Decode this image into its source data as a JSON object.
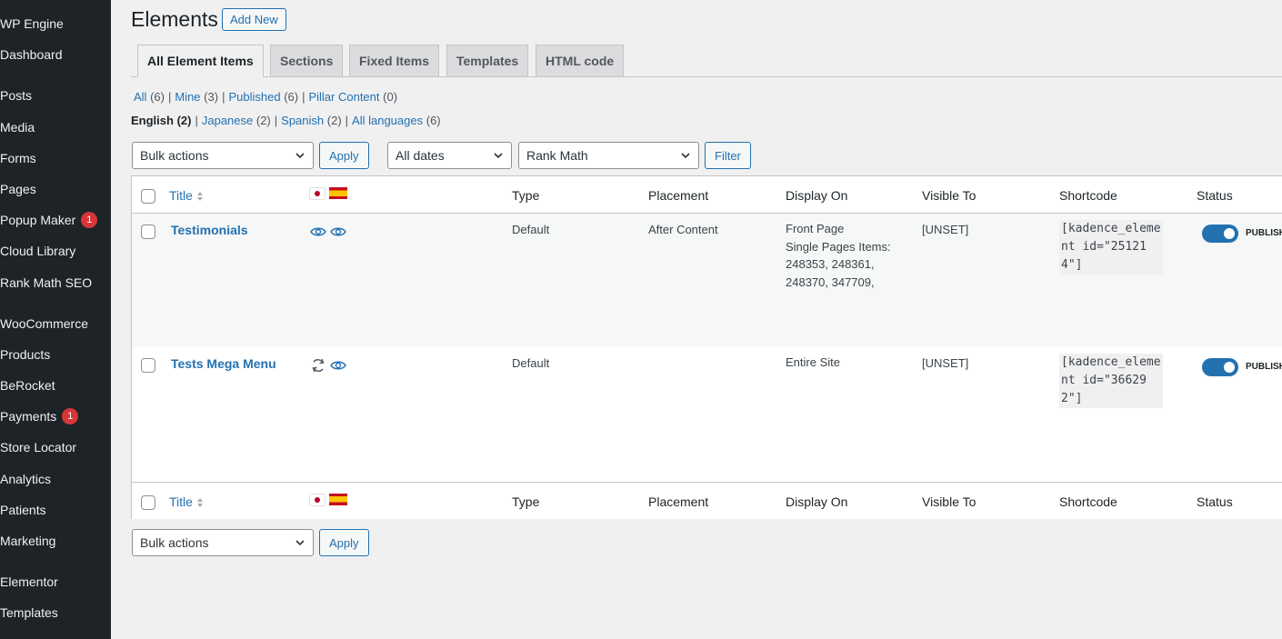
{
  "sidebar": {
    "items": [
      {
        "label": "WP Engine"
      },
      {
        "label": "Dashboard"
      },
      {
        "label": "Posts"
      },
      {
        "label": "Media"
      },
      {
        "label": "Forms"
      },
      {
        "label": "Pages"
      },
      {
        "label": "Popup Maker",
        "badge": "1"
      },
      {
        "label": "Cloud Library"
      },
      {
        "label": "Rank Math SEO"
      },
      {
        "label": "WooCommerce"
      },
      {
        "label": "Products"
      },
      {
        "label": "BeRocket"
      },
      {
        "label": "Payments",
        "badge": "1"
      },
      {
        "label": "Store Locator"
      },
      {
        "label": "Analytics"
      },
      {
        "label": "Patients"
      },
      {
        "label": "Marketing"
      },
      {
        "label": "Elementor"
      },
      {
        "label": "Templates"
      }
    ]
  },
  "header": {
    "title": "Elements",
    "add_new": "Add New"
  },
  "tabs": [
    {
      "label": "All Element Items",
      "active": true
    },
    {
      "label": "Sections"
    },
    {
      "label": "Fixed Items"
    },
    {
      "label": "Templates"
    },
    {
      "label": "HTML code"
    }
  ],
  "views": [
    {
      "label": "All",
      "count": "(6)"
    },
    {
      "label": "Mine",
      "count": "(3)"
    },
    {
      "label": "Published",
      "count": "(6)"
    },
    {
      "label": "Pillar Content",
      "count": "(0)"
    }
  ],
  "languages": [
    {
      "label": "English",
      "count": "(2)",
      "current": true
    },
    {
      "label": "Japanese",
      "count": "(2)"
    },
    {
      "label": "Spanish",
      "count": "(2)"
    },
    {
      "label": "All languages",
      "count": "(6)"
    }
  ],
  "filters": {
    "bulk_actions": "Bulk actions",
    "apply": "Apply",
    "dates": "All dates",
    "seo": "Rank Math",
    "filter": "Filter"
  },
  "table": {
    "columns": {
      "title": "Title",
      "type": "Type",
      "placement": "Placement",
      "display_on": "Display On",
      "visible_to": "Visible To",
      "shortcode": "Shortcode",
      "status": "Status"
    },
    "rows": [
      {
        "title": "Testimonials",
        "type": "Default",
        "placement": "After Content",
        "display_on": [
          "Front Page",
          "Single Pages Items:",
          "248353, 248361,",
          "248370, 347709,"
        ],
        "visible_to": "[UNSET]",
        "shortcode": "[kadence_element id=\"251214\"]",
        "status": "PUBLISH"
      },
      {
        "title": "Tests Mega Menu",
        "type": "Default",
        "placement": "",
        "display_on": [
          "Entire Site"
        ],
        "visible_to": "[UNSET]",
        "shortcode": "[kadence_element id=\"366292\"]",
        "status": "PUBLISH"
      }
    ]
  },
  "bottom": {
    "bulk_actions": "Bulk actions",
    "apply": "Apply"
  },
  "colors": {
    "sidebar_bg": "#1d2327",
    "accent": "#2271b1",
    "badge": "#d63638",
    "page_bg": "#f0f0f1"
  }
}
